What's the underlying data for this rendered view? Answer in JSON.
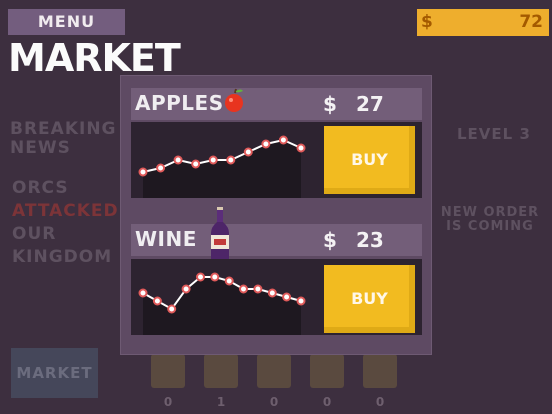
{
  "background": {
    "news_title": "BREAKING NEWS",
    "news_lines": [
      "ORCS",
      "ATTACKED",
      "OUR",
      "KINGDOM"
    ],
    "level_text": "LEVEL 3",
    "order_text": "NEW ORDER IS COMING",
    "market_button_label": "MARKET",
    "tool_counts": [
      "0",
      "1",
      "0",
      "0",
      "0"
    ]
  },
  "header": {
    "menu_label": "MENU",
    "title": "MARKET",
    "money_symbol": "$",
    "money_amount": "72"
  },
  "market": {
    "items": [
      {
        "name": "APPLES",
        "icon": "apple-icon",
        "currency": "$",
        "price": "27",
        "buy_label": "BUY",
        "price_history": [
          3,
          4,
          6,
          5,
          6,
          6,
          8,
          10,
          11,
          9
        ]
      },
      {
        "name": "WINE",
        "icon": "wine-bottle-icon",
        "currency": "$",
        "price": "23",
        "buy_label": "BUY",
        "price_history": [
          7,
          5,
          3,
          8,
          11,
          11,
          10,
          8,
          8,
          7,
          6,
          5
        ]
      }
    ]
  },
  "colors": {
    "background": "#3d2f3f",
    "panel": "#5e4a63",
    "accent_gold": "#f2bb20",
    "money_bar": "#eeae2d",
    "chart_line": "#ffffff",
    "chart_point_ring": "#e05a5a"
  }
}
